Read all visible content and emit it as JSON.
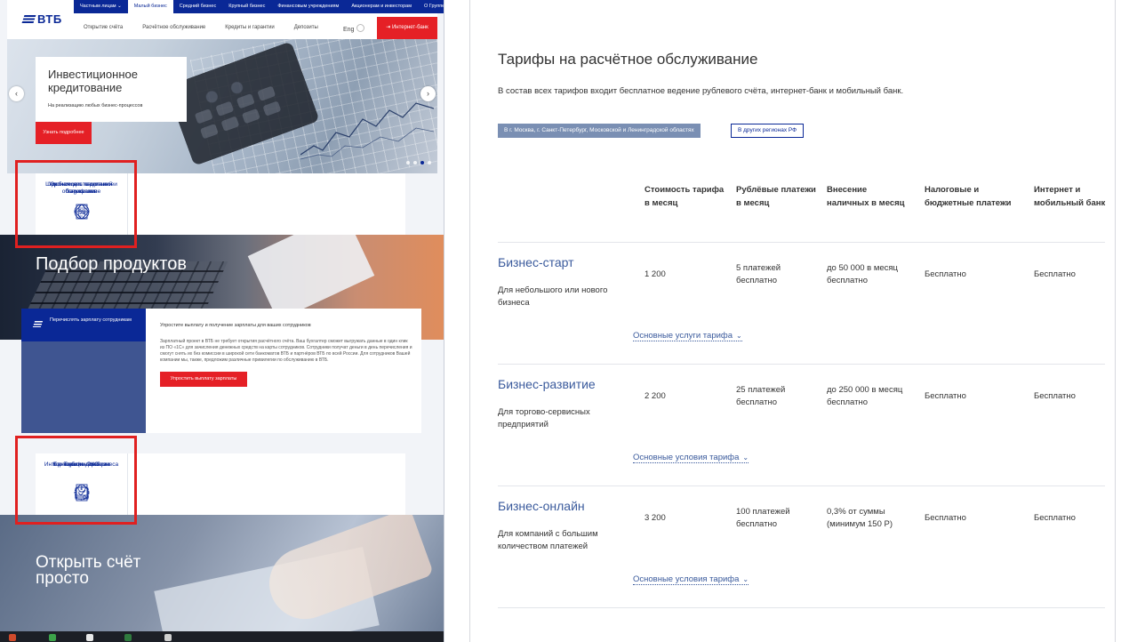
{
  "left": {
    "logo": "ВТБ",
    "top_nav": [
      "Частным лицам ⌄",
      "Малый бизнес",
      "Средний бизнес",
      "Крупный бизнес",
      "Финансовым учреждениям",
      "Акционерам и инвесторам",
      "О Группе ВТБ"
    ],
    "sub_nav": [
      "Открытие счёта",
      "Расчётное обслуживание",
      "Кредиты и гарантии",
      "Депозиты"
    ],
    "lang": "Eng",
    "internet_bank": "Интернет-банк",
    "hero": {
      "title": "Инвестиционное кредитование",
      "subtitle": "На реализацию любых бизнес-процессов",
      "button": "Узнать подробнее",
      "prev": "‹",
      "next": "›"
    },
    "features": [
      "Экономия с пакетными тарифами",
      "Удобное дистанционное обслуживание",
      "Широкая сеть отделений и банкоматов"
    ],
    "product_section": {
      "title": "Подбор продуктов",
      "tab": "Перечислять зарплату сотрудникам",
      "heading": "Упростите выплату и получение зарплаты для ваших сотрудников",
      "text": "Зарплатный проект в ВТБ не требует открытия расчётного счёта. Ваш бухгалтер сможет выгружать данные в один клик из ПО «1С» для зачисления денежных средств на карты сотрудников. Сотрудники получат деньги в день перечисления и смогут снять их без комиссии в широкой сети банкоматов ВТБ и партнёров ВТБ по всей России. Для сотрудников Вашей компании мы, также, предложим различные привилегии по обслуживанию в ВТБ.",
      "button": "Упростить выплату зарплаты"
    },
    "features2": [
      "Тарифы РКО",
      "Корпоративная карта",
      "Интернет-банк для бизнеса",
      "Банковские гарантии"
    ],
    "bottom_banner": "Открыть счёт просто"
  },
  "right": {
    "title": "Тарифы на расчётное обслуживание",
    "subtitle": "В состав всех тарифов входит бесплатное ведение рублевого счёта, интернет-банк и мобильный банк.",
    "region_tabs": [
      "В г. Москва, г. Санкт-Петербург, Московской и Ленинградской областях",
      "В других регионах РФ"
    ],
    "columns": [
      "Стоимость тарифа в месяц",
      "Рублёвые платежи в месяц",
      "Внесение наличных в месяц",
      "Налоговые и бюджетные платежи",
      "Интернет и мобильный банк"
    ],
    "tariffs": [
      {
        "name": "Бизнес-старт",
        "desc": "Для небольшого или нового бизнеса",
        "price": "1 200",
        "payments": "5 платежей бесплатно",
        "cash": "до 50 000 в месяц бесплатно",
        "tax": "Бесплатно",
        "bank": "Бесплатно",
        "link": "Основные услуги тарифа"
      },
      {
        "name": "Бизнес-развитие",
        "desc": "Для торгово-сервисных предприятий",
        "price": "2 200",
        "payments": "25 платежей бесплатно",
        "cash": "до 250 000 в месяц бесплатно",
        "tax": "Бесплатно",
        "bank": "Бесплатно",
        "link": "Основные условия тарифа"
      },
      {
        "name": "Бизнес-онлайн",
        "desc": "Для компаний с большим количеством платежей",
        "price": "3 200",
        "payments": "100 платежей бесплатно",
        "cash": "0,3% от суммы (минимум 150 Р)",
        "tax": "Бесплатно",
        "bank": "Бесплатно",
        "link": "Основные условия тарифа"
      }
    ],
    "chevron": "⌄"
  },
  "colors": {
    "brand": "#0a2896",
    "accent_red": "#e52026",
    "link": "#3a5a9c",
    "highlight": "#e02020"
  }
}
